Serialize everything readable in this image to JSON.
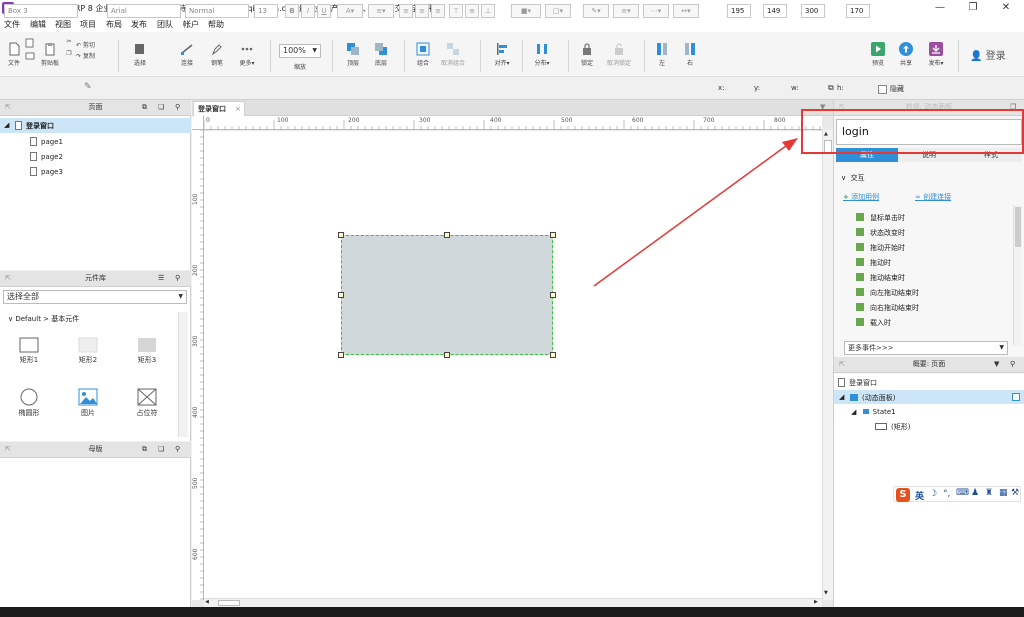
{
  "titlebar": {
    "app_icon": "RP",
    "title": "未命名 - Axure RP 8 企业版：未授权 汉化支持：起点学院www.qidianla.com最专业的产品经理、运营、交互学习平台"
  },
  "menu": [
    "文件",
    "编辑",
    "视图",
    "项目",
    "布局",
    "发布",
    "团队",
    "帐户",
    "帮助"
  ],
  "toolbar": {
    "file": "文件",
    "clipboard": "剪贴板",
    "cut": "剪切",
    "paste": "复制",
    "select": "选择",
    "connect": "连接",
    "pen": "钢笔",
    "more": "更多▾",
    "zoom_value": "100%",
    "zoom_label": "缩放",
    "top": "顶层",
    "bottom": "底层",
    "group": "组合",
    "ungroup": "取消组合",
    "align": "对齐▾",
    "distribute": "分布▾",
    "lock": "锁定",
    "unlock": "取消锁定",
    "left": "左",
    "right": "右",
    "preview": "预览",
    "share": "共享",
    "publish": "发布▾",
    "login": "登录"
  },
  "format": {
    "style": "Box 3",
    "font": "Arial",
    "weight": "Normal",
    "size": "13",
    "x_label": "x:",
    "x": "195",
    "y_label": "y:",
    "y": "149",
    "w_label": "w:",
    "w": "300",
    "h_label": "h:",
    "h": "170",
    "hidden": "隐藏"
  },
  "pages_panel": {
    "title": "页面",
    "root": "登录窗口",
    "pages": [
      "page1",
      "page2",
      "page3"
    ]
  },
  "library_panel": {
    "title": "元件库",
    "select": "选择全部",
    "group": "Default > 基本元件",
    "items": [
      "矩形1",
      "矩形2",
      "矩形3",
      "椭圆形",
      "图片",
      "占位符"
    ]
  },
  "masters_panel": {
    "title": "母版"
  },
  "canvas": {
    "tab": "登录窗口",
    "ruler_top": [
      "0",
      "100",
      "200",
      "300",
      "400",
      "500",
      "600",
      "700",
      "800"
    ],
    "ruler_left": [
      "100",
      "200",
      "300",
      "400",
      "500",
      "600"
    ]
  },
  "inspector": {
    "title": "检视: 动态面板",
    "name_value": "login",
    "tabs": [
      "属性",
      "说明",
      "样式"
    ],
    "section": "交互",
    "add_case": "添加用例",
    "create_link": "创建连接",
    "events": [
      "鼠标单击时",
      "状态改变时",
      "拖动开始时",
      "拖动时",
      "拖动结束时",
      "向左拖动结束时",
      "向右拖动结束时",
      "载入时"
    ],
    "more_events": "更多事件>>>"
  },
  "outline": {
    "title": "概要: 页面",
    "root": "登录窗口",
    "panel": "(动态面板)",
    "state": "State1",
    "shape": "(矩形)"
  },
  "ime": {
    "label": "英"
  },
  "colors": {
    "accent": "#2f8fd8",
    "annotation": "#e53935",
    "widget_fill": "#d0d8dc",
    "selection": "#32c832"
  }
}
